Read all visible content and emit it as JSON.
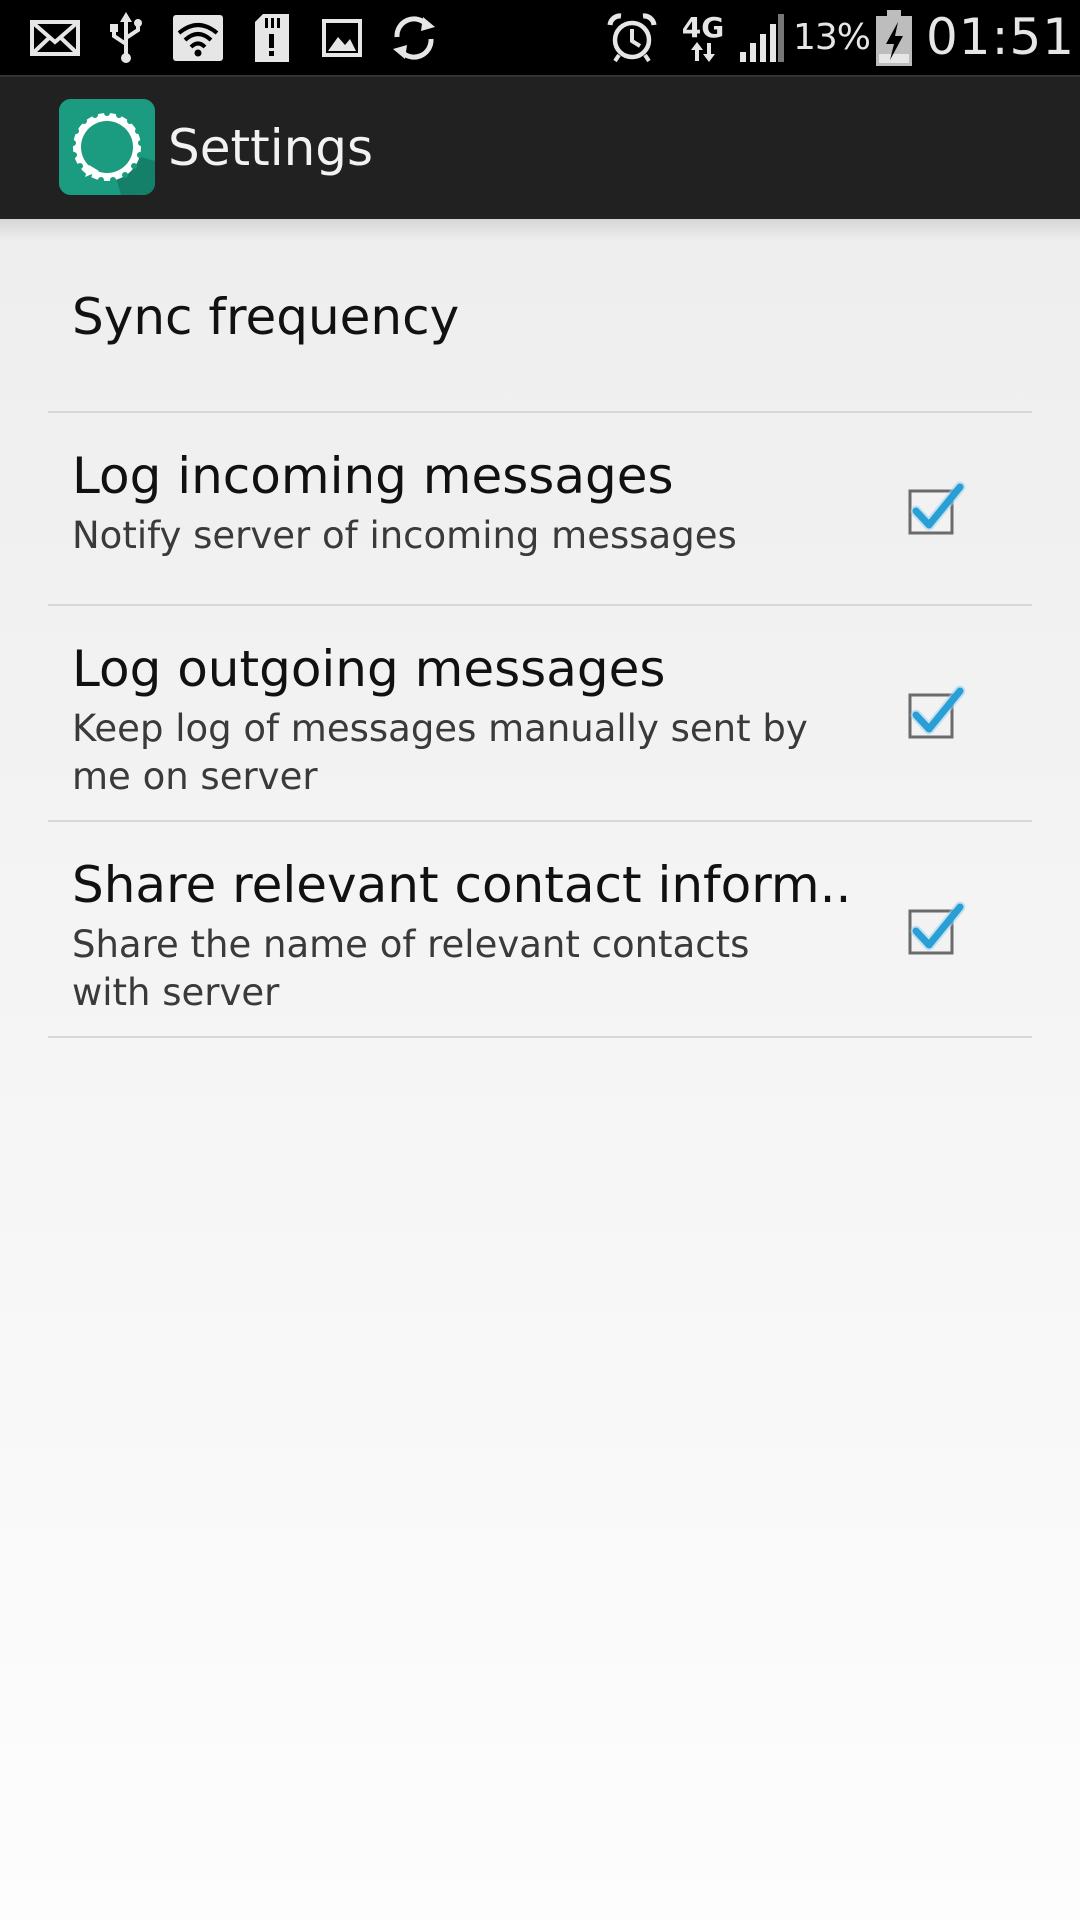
{
  "status_bar": {
    "icons": [
      "mail-icon",
      "usb-icon",
      "wifi-icon",
      "sd-card-icon",
      "image-icon",
      "sync-icon",
      "alarm-icon",
      "network-4g-icon",
      "signal-icon",
      "battery-charging-icon"
    ],
    "network_type": "4G",
    "battery_percent": "13%",
    "time": "01:51"
  },
  "action_bar": {
    "title": "Settings",
    "app_icon": "app-settings-icon",
    "background_color": "#212121",
    "icon_color": "#1b9b7f"
  },
  "preferences": [
    {
      "title": "Sync frequency"
    },
    {
      "title": "Log incoming messages",
      "summary": "Notify server of incoming messages",
      "checked": true
    },
    {
      "title": "Log outgoing messages",
      "summary": "Keep log of messages manually sent by me on server",
      "checked": true
    },
    {
      "title": "Share relevant contact inform..",
      "summary": "Share the name of relevant contacts with server",
      "checked": true
    }
  ],
  "colors": {
    "checkmark": "#2a9fd6",
    "divider": "#d7d7d7"
  }
}
